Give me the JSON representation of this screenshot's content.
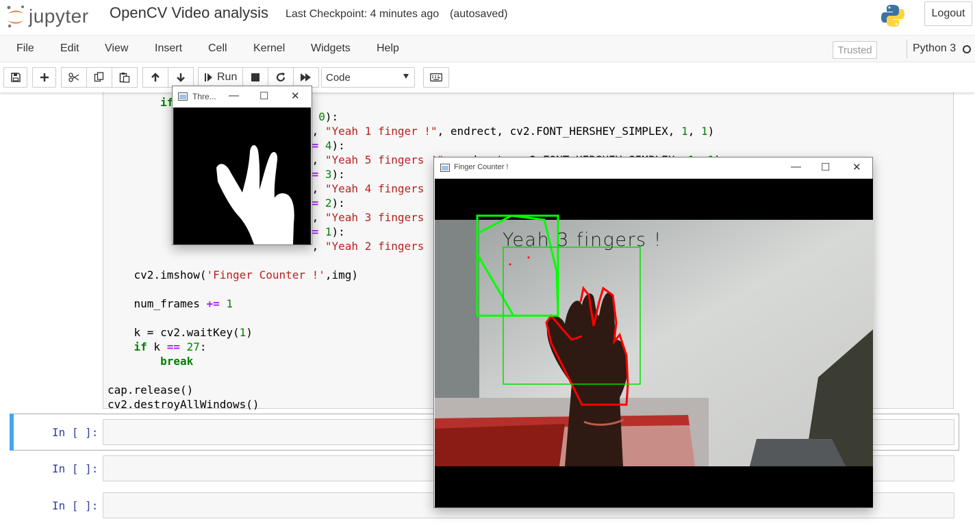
{
  "header": {
    "logo_text": "jupyter",
    "notebook_title": "OpenCV Video analysis",
    "checkpoint": "Last Checkpoint: 4 minutes ago",
    "autosave": "(autosaved)",
    "logout_label": "Logout"
  },
  "menu": {
    "items": [
      "File",
      "Edit",
      "View",
      "Insert",
      "Cell",
      "Kernel",
      "Widgets",
      "Help"
    ],
    "trusted": "Trusted",
    "kernel": "Python 3"
  },
  "toolbar": {
    "run_label": "Run",
    "cell_type": "Code",
    "icons": [
      "save-icon",
      "plus-icon",
      "scissors-icon",
      "copy-icon",
      "paste-icon",
      "arrow-up-icon",
      "arrow-down-icon",
      "run-icon",
      "stop-icon",
      "restart-icon",
      "fast-forward-icon",
      "keyboard-icon"
    ]
  },
  "code_lines": [
    "        if",
    "                                0):",
    "                               , \"Yeah 1 finger !\", endrect, cv2.FONT_HERSHEY_SIMPLEX, 1, 1)",
    "                              == 4):",
    "                               , \"Yeah 5 fingers !\", endrect, cv2.FONT_HERSHEY_SIMPLEX, 1, 1)",
    "                              == 3):",
    "                               , \"Yeah 4 fingers",
    "                              == 2):",
    "                               , \"Yeah 3 fingers",
    "                              == 1):",
    "                               , \"Yeah 2 fingers",
    "",
    "    cv2.imshow('Finger Counter !',img)",
    "",
    "    num_frames += 1",
    "",
    "    k = cv2.waitKey(1)",
    "    if k == 27:",
    "        break",
    "",
    "cap.release()",
    "cv2.destroyAllWindows()"
  ],
  "empty_cells": [
    {
      "prompt": "In [ ]:"
    },
    {
      "prompt": "In [ ]:"
    },
    {
      "prompt": "In [ ]:"
    }
  ],
  "threshold_window": {
    "title": "Thre..."
  },
  "finger_window": {
    "title": "Finger Counter !",
    "overlay_text": "Yeah 3 fingers !"
  },
  "colors": {
    "prompt": "#303f9f",
    "selected_bar": "#42a5f5",
    "jupyter_orange": "#f37626",
    "keyword_green": "#008000",
    "string_red": "#ba2121",
    "operator_purple": "#aa22ff",
    "number_green": "#008000",
    "contour_green": "#00ff00",
    "contour_red": "#ff0000"
  }
}
